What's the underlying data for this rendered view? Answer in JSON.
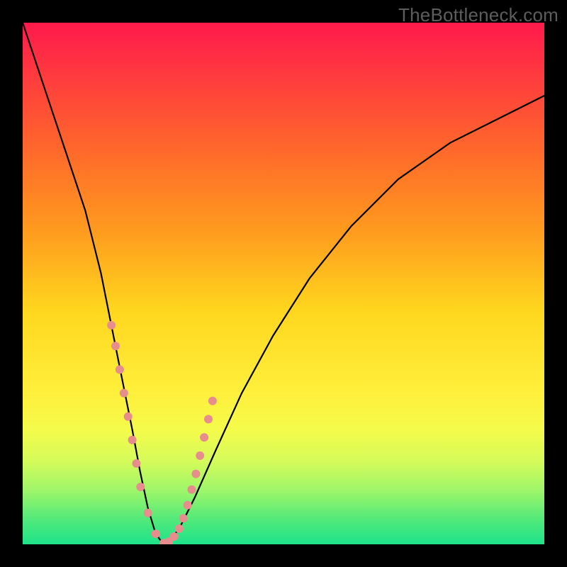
{
  "watermark": "TheBottleneck.com",
  "colors": {
    "frame": "#000000",
    "curve": "#000000",
    "dot": "#e78d8d",
    "gradient_top": "#ff1a4c",
    "gradient_bottom": "#1de28a"
  },
  "chart_data": {
    "type": "line",
    "title": "",
    "xlabel": "",
    "ylabel": "",
    "xlim": [
      0,
      100
    ],
    "ylim": [
      0,
      100
    ],
    "series": [
      {
        "name": "bottleneck-curve",
        "x": [
          0,
          4,
          8,
          12,
          15,
          17,
          19,
          21,
          22.5,
          24,
          25.5,
          27,
          28,
          30,
          33,
          37,
          42,
          48,
          55,
          63,
          72,
          82,
          92,
          100
        ],
        "y": [
          100,
          88,
          76,
          64,
          52,
          42,
          32,
          22,
          14,
          7,
          2,
          0,
          0.5,
          3,
          9,
          18,
          29,
          40,
          51,
          61,
          70,
          77,
          82,
          86
        ]
      }
    ],
    "markers": {
      "name": "highlight-dots",
      "x": [
        17.0,
        17.8,
        18.6,
        19.4,
        20.2,
        21.0,
        21.8,
        22.6,
        24.0,
        25.5,
        27.0,
        28.0,
        29.0,
        30.0,
        30.8,
        31.6,
        32.4,
        33.2,
        34.0,
        34.8,
        35.6,
        36.4
      ],
      "y": [
        42.0,
        38.0,
        33.5,
        29.0,
        24.5,
        20.0,
        15.5,
        11.0,
        6.0,
        2.0,
        0.2,
        0.5,
        1.5,
        3.0,
        5.0,
        7.5,
        10.5,
        13.5,
        17.0,
        20.5,
        24.0,
        27.5
      ],
      "r": 6
    }
  }
}
